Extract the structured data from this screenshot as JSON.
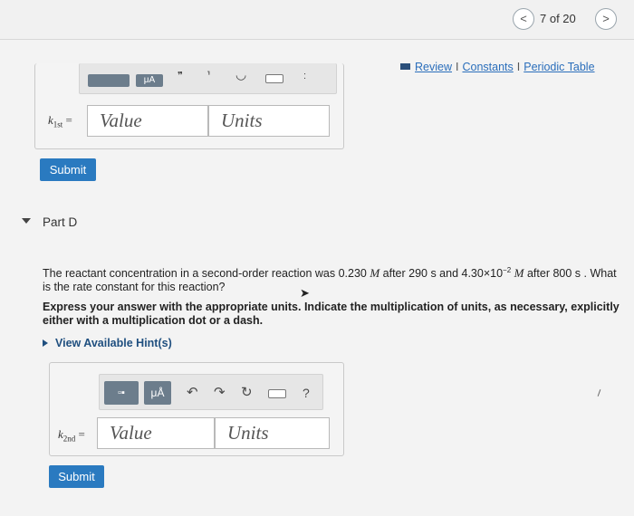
{
  "nav": {
    "prev": "<",
    "page": "7 of 20",
    "next": ">"
  },
  "links": {
    "review": "Review",
    "constants": "Constants",
    "periodic_table": "Periodic Table",
    "separator": "I"
  },
  "part_c": {
    "toolbar": {
      "mu_a": "μA"
    },
    "label_var": "k",
    "label_sub": "1st",
    "label_eq": "=",
    "value_placeholder": "Value",
    "units_placeholder": "Units",
    "submit": "Submit"
  },
  "part_d": {
    "title": "Part D",
    "question": {
      "t1": "The reactant concentration in a second-order reaction was 0.230 ",
      "m": "M",
      "t2": " after 290 s and 4.30×10",
      "exp": "−2",
      "t3": " after 800 s . What is the rate constant for this reaction?"
    },
    "instruction": "Express your answer with the appropriate units. Indicate the multiplication of units, as necessary, explicitly either with a multiplication dot or a dash.",
    "hints": "View Available Hint(s)",
    "toolbar": {
      "mu_a": "μÅ",
      "help": "?"
    },
    "label_var": "k",
    "label_sub": "2nd",
    "label_eq": "=",
    "value_placeholder": "Value",
    "units_placeholder": "Units",
    "submit": "Submit"
  }
}
